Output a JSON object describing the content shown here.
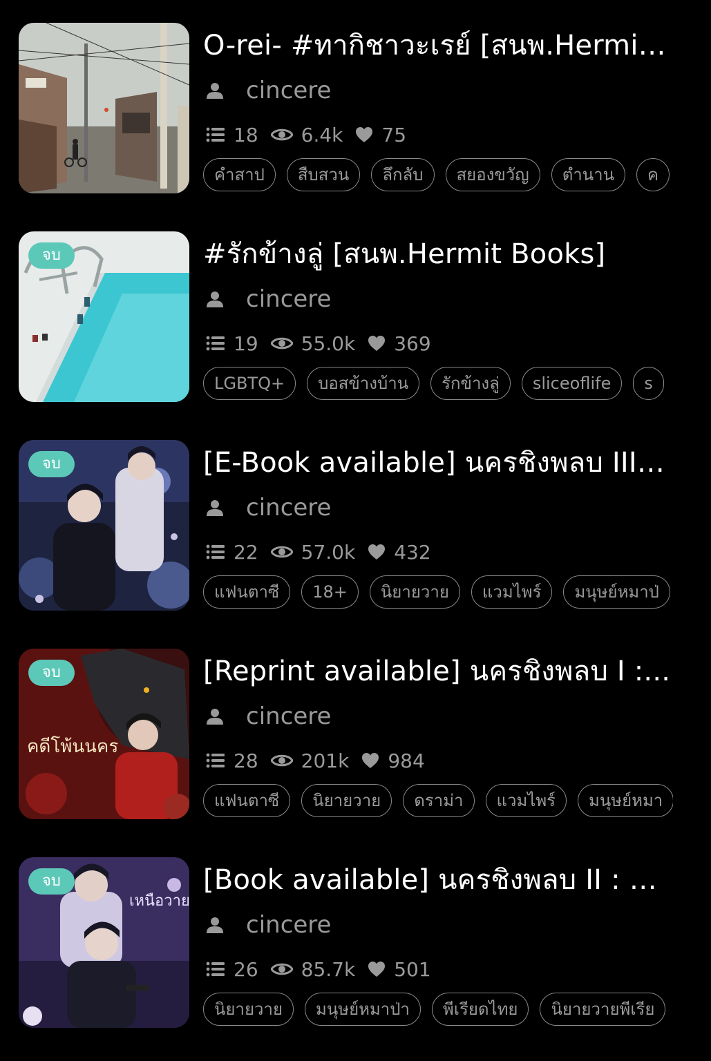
{
  "stories": [
    {
      "title": "O-rei- #ทากิชาวะเรย์ [สนพ.Hermit b...",
      "author": "cincere",
      "badge": "",
      "chapters": "18",
      "views": "6.4k",
      "likes": "75",
      "tags": [
        "คำสาป",
        "สืบสวน",
        "ลึกลับ",
        "สยองขวัญ",
        "ตำนาน",
        "ค"
      ]
    },
    {
      "title": "#รักข้างลู่ [สนพ.Hermit Books]",
      "author": "cincere",
      "badge": "จบ",
      "chapters": "19",
      "views": "55.0k",
      "likes": "369",
      "tags": [
        "LGBTQ+",
        "บอสข้างบ้าน",
        "รักข้างลู่",
        "sliceoflife",
        "s"
      ]
    },
    {
      "title": "[E-Book available] นครชิงพลบ III :...",
      "author": "cincere",
      "badge": "จบ",
      "chapters": "22",
      "views": "57.0k",
      "likes": "432",
      "tags": [
        "แฟนตาซี",
        "18+",
        "นิยายวาย",
        "แวมไพร์",
        "มนุษย์หมาป่"
      ]
    },
    {
      "title": "[Reprint available] นครชิงพลบ I :...",
      "author": "cincere",
      "badge": "จบ",
      "chapters": "28",
      "views": "201k",
      "likes": "984",
      "tags": [
        "แฟนตาซี",
        "นิยายวาย",
        "ดราม่า",
        "แวมไพร์",
        "มนุษย์หมา"
      ]
    },
    {
      "title": "[Book available] นครชิงพลบ II : #เ...",
      "author": "cincere",
      "badge": "จบ",
      "chapters": "26",
      "views": "85.7k",
      "likes": "501",
      "tags": [
        "นิยายวาย",
        "มนุษย์หมาป่า",
        "พีเรียดไทย",
        "นิยายวายพีเรีย"
      ]
    }
  ],
  "cover_art": {
    "cover_1": "street-photo",
    "cover_2": "swimming-pool-photo",
    "cover_3": "illustration-two-men-flowers",
    "cover_4": "illustration-wolf-red",
    "cover_5": "illustration-twins-purple",
    "cover_4_lettering": "คดีโพ้นนคร",
    "cover_5_lettering": "เหนือวาย"
  },
  "colors": {
    "background": "#000000",
    "badge": "#5cc8b8",
    "meta_text": "#9a9a9a"
  },
  "icons": {
    "author": "person-icon",
    "chapters": "list-icon",
    "views": "eye-icon",
    "likes": "heart-icon"
  }
}
